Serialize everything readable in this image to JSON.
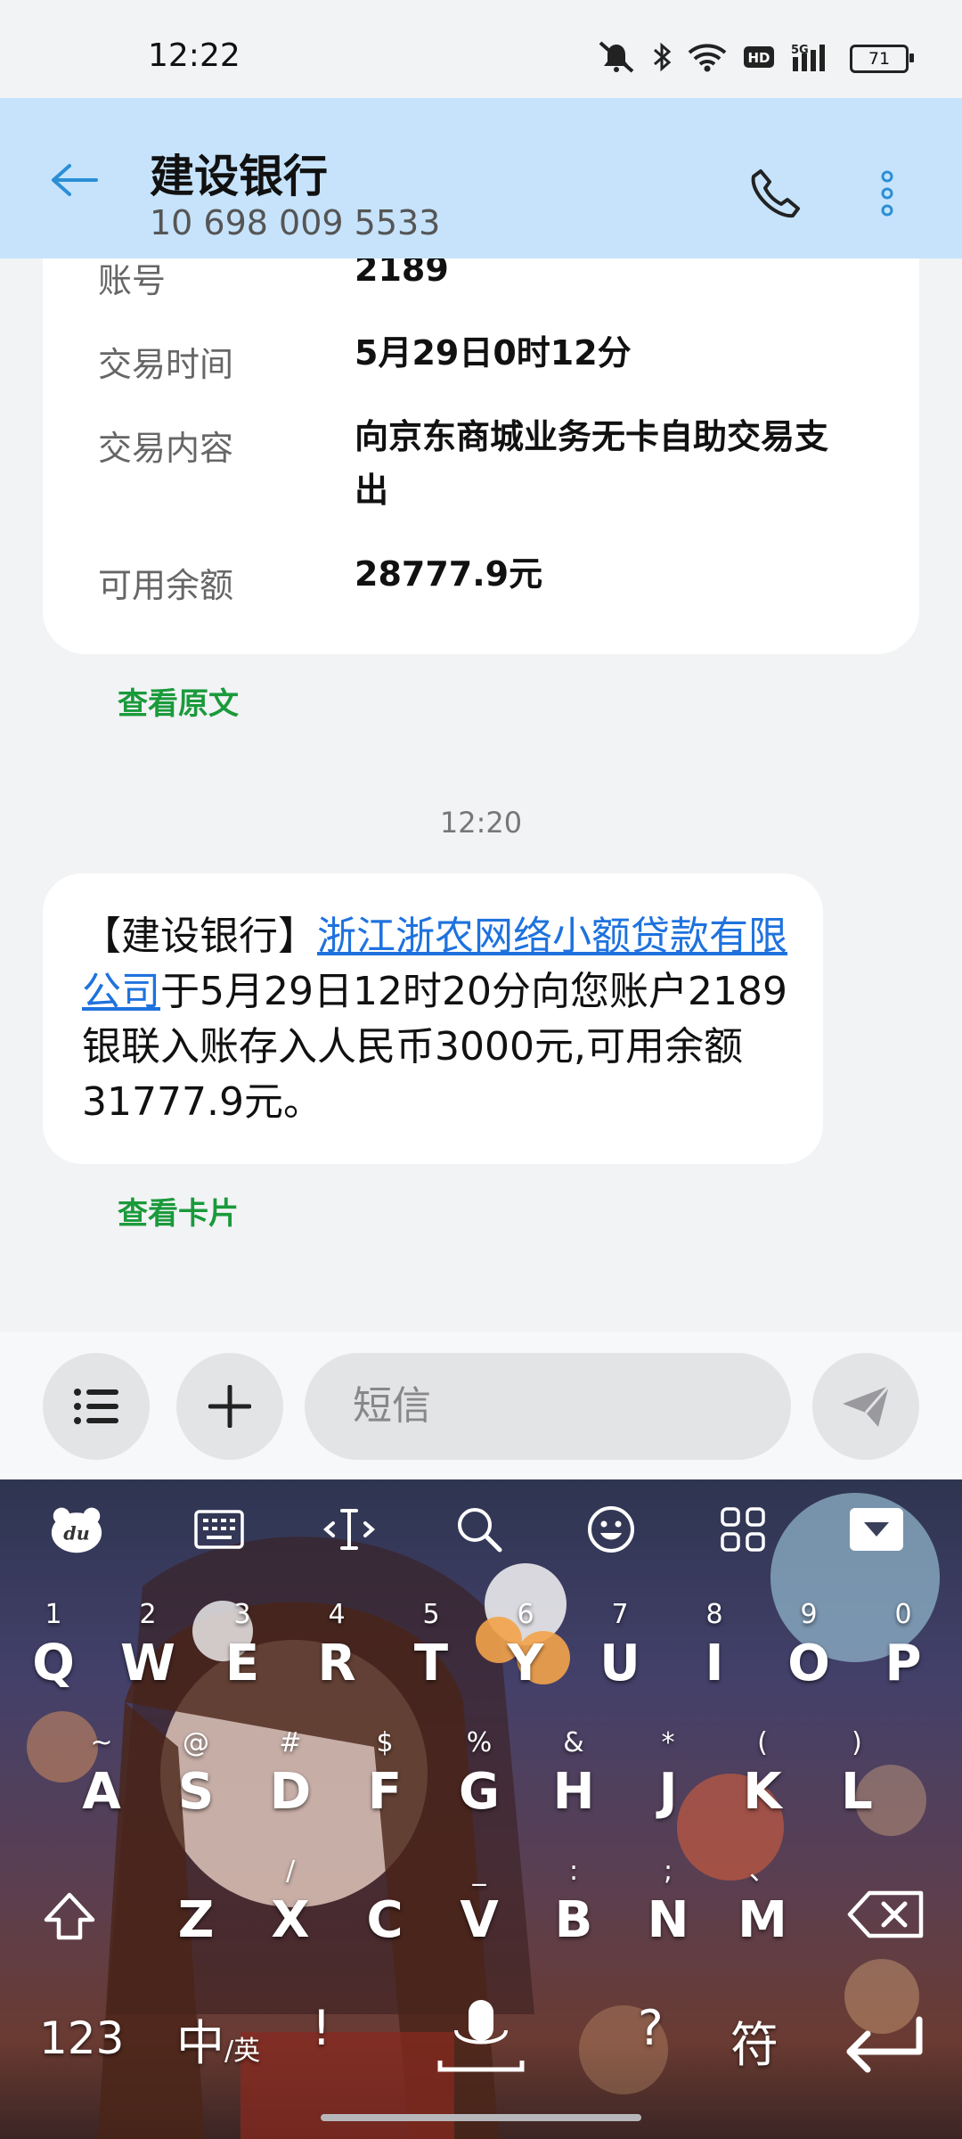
{
  "status_bar": {
    "time": "12:22",
    "battery": "71"
  },
  "header": {
    "title": "建设银行",
    "subtitle": "10 698 009 5533"
  },
  "card": {
    "rows": [
      {
        "label": "账号",
        "value": "2189"
      },
      {
        "label": "交易时间",
        "value": "5月29日0时12分"
      },
      {
        "label": "交易内容",
        "value": "向京东商城业务无卡自助交易支出"
      },
      {
        "label": "可用余额",
        "value": "28777.9元"
      }
    ],
    "view_original": "查看原文"
  },
  "message": {
    "time": "12:20",
    "prefix": "【建设银行】",
    "link": "浙江浙农网络小额贷款有限公司",
    "body": "于5月29日12时20分向您账户2189银联入账存入人民币3000元,可用余额31777.9元。",
    "view_card": "查看卡片"
  },
  "input": {
    "placeholder": "短信"
  },
  "keyboard": {
    "row1": [
      {
        "hint": "1",
        "key": "Q"
      },
      {
        "hint": "2",
        "key": "W"
      },
      {
        "hint": "3",
        "key": "E"
      },
      {
        "hint": "4",
        "key": "R"
      },
      {
        "hint": "5",
        "key": "T"
      },
      {
        "hint": "6",
        "key": "Y"
      },
      {
        "hint": "7",
        "key": "U"
      },
      {
        "hint": "8",
        "key": "I"
      },
      {
        "hint": "9",
        "key": "O"
      },
      {
        "hint": "0",
        "key": "P"
      }
    ],
    "row2": [
      {
        "hint": "~",
        "key": "A"
      },
      {
        "hint": "@",
        "key": "S"
      },
      {
        "hint": "#",
        "key": "D"
      },
      {
        "hint": "$",
        "key": "F"
      },
      {
        "hint": "%",
        "key": "G"
      },
      {
        "hint": "&",
        "key": "H"
      },
      {
        "hint": "*",
        "key": "J"
      },
      {
        "hint": "(",
        "key": "K"
      },
      {
        "hint": ")",
        "key": "L"
      }
    ],
    "row3": [
      {
        "hint": "",
        "key": "Z"
      },
      {
        "hint": "/",
        "key": "X"
      },
      {
        "hint": "",
        "key": "C"
      },
      {
        "hint": "_",
        "key": "V"
      },
      {
        "hint": ":",
        "key": "B"
      },
      {
        "hint": ";",
        "key": "N"
      },
      {
        "hint": "、",
        "key": "M"
      }
    ],
    "num_label": "123",
    "lang_label": "中",
    "lang_sub": "/英",
    "excl": "!",
    "question": "?",
    "symbol_label": "符"
  }
}
